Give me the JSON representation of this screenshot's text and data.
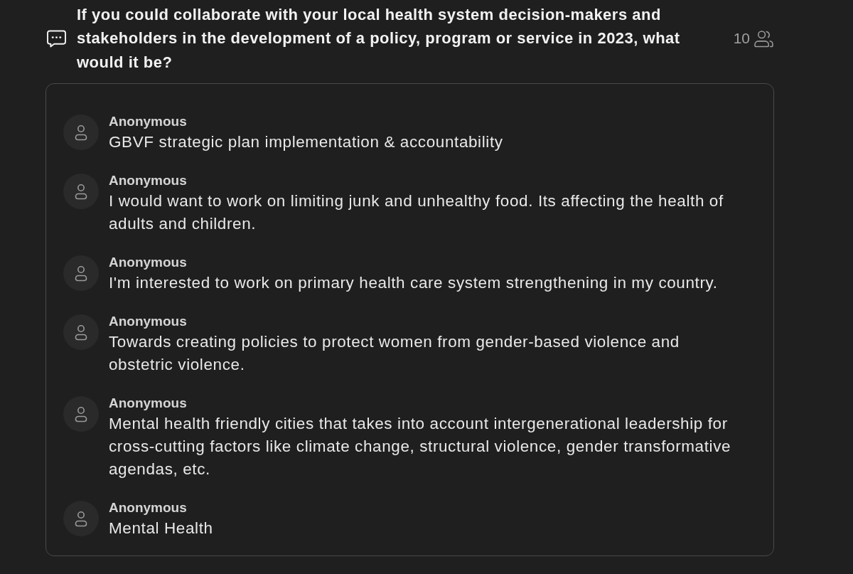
{
  "question": {
    "text": "If you could collaborate with your local health system decision-makers and stakeholders in the development of a policy, program or service in 2023, what would it be?",
    "response_count": "10"
  },
  "responses": [
    {
      "author": "Anonymous",
      "text": "GBVF strategic plan implementation & accountability"
    },
    {
      "author": "Anonymous",
      "text": "I would want to work on limiting junk and unhealthy food. Its affecting the health of adults and children."
    },
    {
      "author": "Anonymous",
      "text": "I'm interested to work on primary health care system strengthening in my country."
    },
    {
      "author": "Anonymous",
      "text": "Towards creating policies to protect women from gender-based violence and obstetric violence."
    },
    {
      "author": "Anonymous",
      "text": "Mental health friendly cities that takes into account intergenerational leadership for cross-cutting factors like climate change, structural violence, gender transformative agendas, etc."
    },
    {
      "author": "Anonymous",
      "text": "Mental Health"
    }
  ]
}
